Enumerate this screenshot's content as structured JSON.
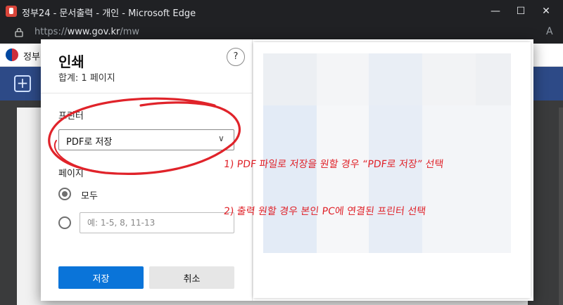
{
  "window": {
    "title": "정부24 - 문서출력 - 개인 - Microsoft Edge",
    "minimize_icon": "minimize-icon",
    "maximize_icon": "maximize-icon",
    "close_icon": "close-icon"
  },
  "address": {
    "url_prefix": "https://",
    "url_domain": "www.gov.kr",
    "url_path": "/mw",
    "read_aloud": "A",
    "lock_icon": "lock-icon"
  },
  "site": {
    "name": "정부",
    "logo_icon": "government-emblem-icon",
    "add_icon": "plus-icon"
  },
  "dialog": {
    "title": "인쇄",
    "subtitle": "합계: 1 페이지",
    "help": "?",
    "printer_label": "프린터",
    "printer_value": "PDF로 저장",
    "pages_label": "페이지",
    "option_all": "모두",
    "option_all_selected": true,
    "pages_placeholder": "예: 1-5, 8, 11-13",
    "save_button": "저장",
    "cancel_button": "취소"
  },
  "annotations": {
    "note1": "1) PDF 파일로 저장을 원할 경우 “PDF로 저장” 선택",
    "note2": "2) 출력 원할 경우 본인 PC에 연결된 프린터 선택",
    "color": "#e0232a"
  }
}
